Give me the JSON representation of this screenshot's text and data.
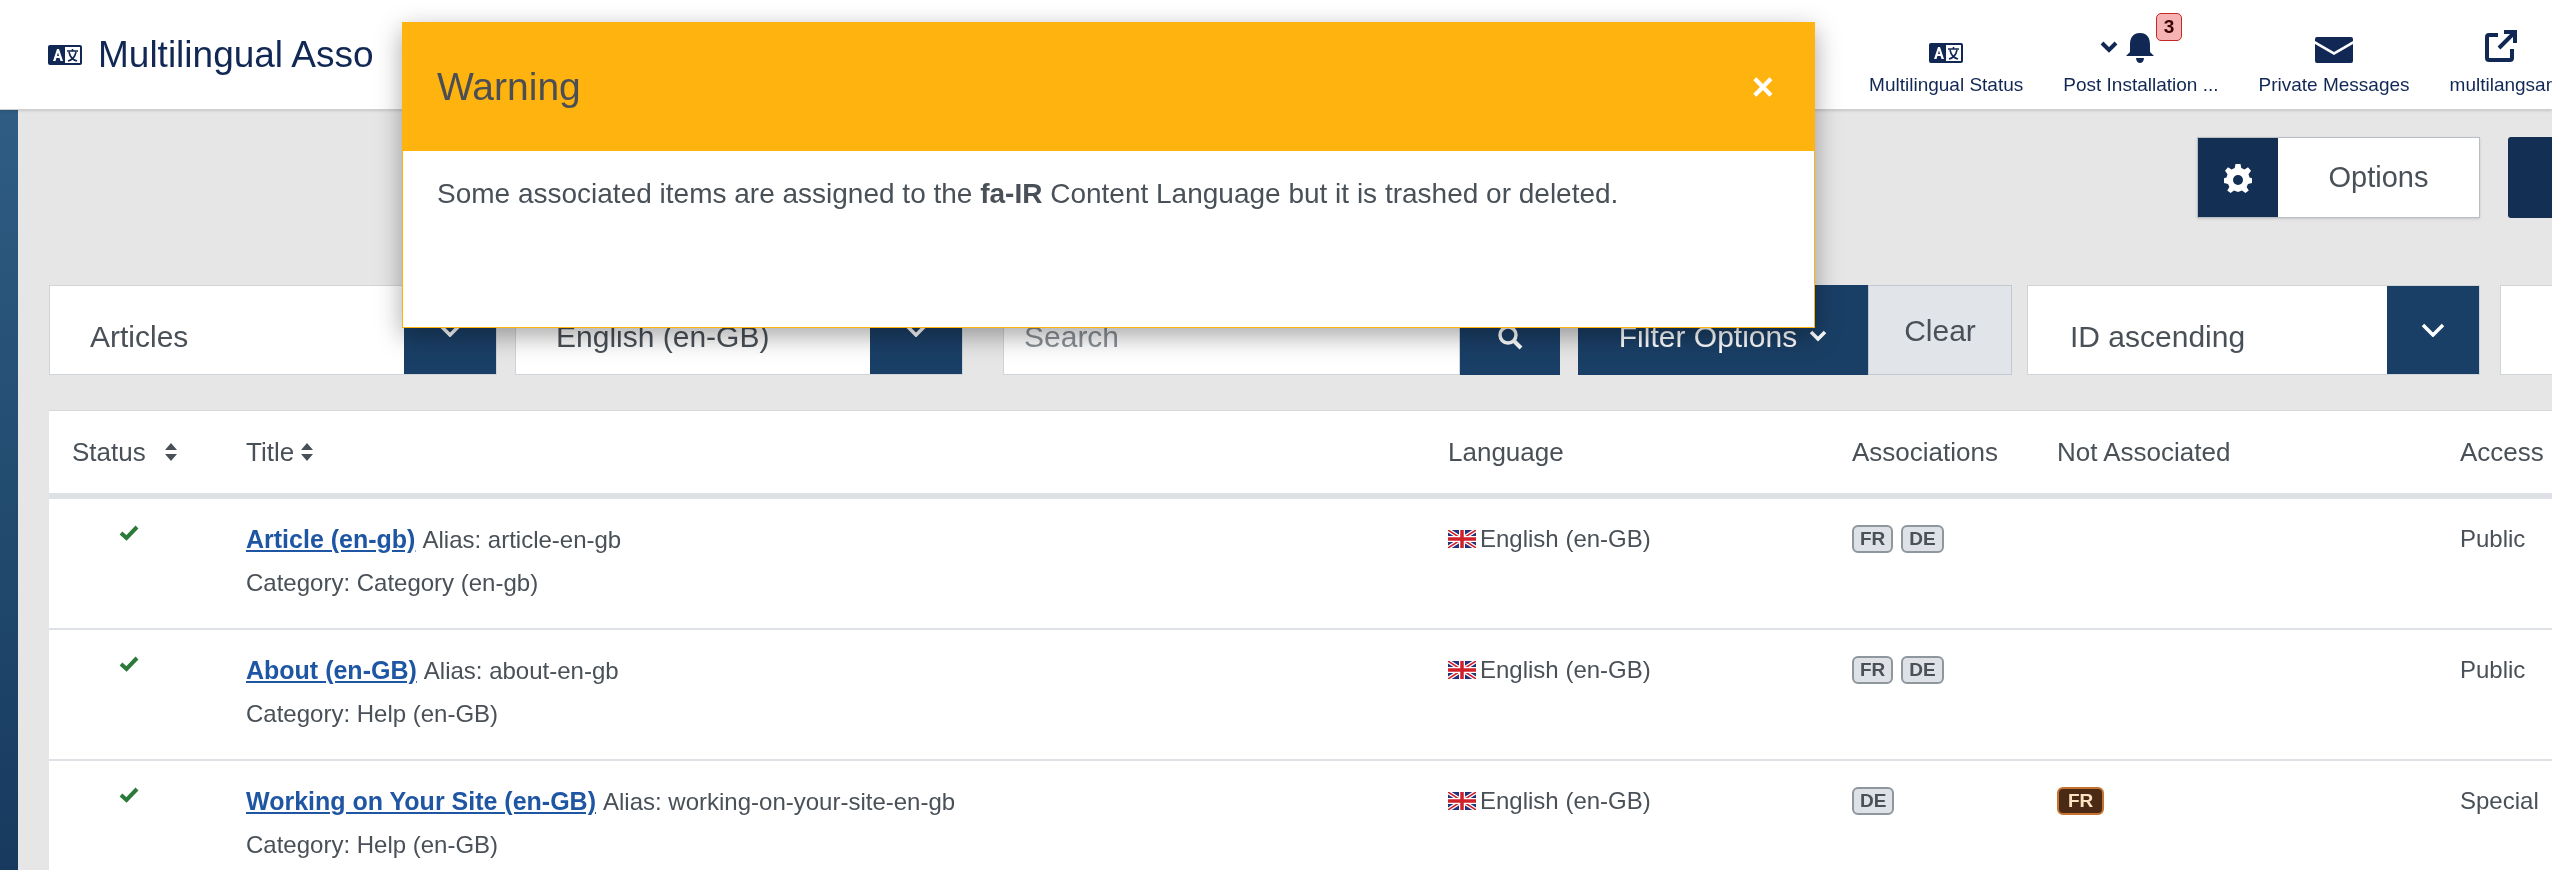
{
  "header": {
    "title": "Multilingual Asso",
    "items": [
      {
        "label": "Multilingual Status"
      },
      {
        "label": "Post Installation ...",
        "badge": "3"
      },
      {
        "label": "Private Messages"
      },
      {
        "label": "multilangsar"
      }
    ]
  },
  "toolbar": {
    "options": "Options"
  },
  "filters": {
    "type_select": "Articles",
    "language_select": "English (en-GB)",
    "search": {
      "placeholder": "Search"
    },
    "filter_options": "Filter Options",
    "clear": "Clear",
    "ordering": "ID ascending"
  },
  "table": {
    "columns": [
      {
        "label": "Status",
        "sortable": true
      },
      {
        "label": "Title",
        "sortable": true
      },
      {
        "label": "Language",
        "sortable": false
      },
      {
        "label": "Associations",
        "sortable": false
      },
      {
        "label": "Not Associated",
        "sortable": false
      },
      {
        "label": "Access",
        "sortable": false
      }
    ],
    "rows": [
      {
        "published": true,
        "title": "Article (en-gb)",
        "alias": "Alias: article-en-gb",
        "category": "Category: Category (en-gb)",
        "language": "English (en-GB)",
        "associations": [
          "FR",
          "DE"
        ],
        "not_associated": [],
        "access": "Public"
      },
      {
        "published": true,
        "title": "About (en-GB)",
        "alias": "Alias: about-en-gb",
        "category": "Category: Help (en-GB)",
        "language": "English (en-GB)",
        "associations": [
          "FR",
          "DE"
        ],
        "not_associated": [],
        "access": "Public"
      },
      {
        "published": true,
        "title": "Working on Your Site (en-GB)",
        "alias": "Alias: working-on-your-site-en-gb",
        "category": "Category: Help (en-GB)",
        "language": "English (en-GB)",
        "associations": [
          "DE"
        ],
        "not_associated": [
          "FR"
        ],
        "access": "Special"
      }
    ]
  },
  "modal": {
    "title": "Warning",
    "close": "×",
    "message": "Some associated items are assigned to the **fa-IR** Content Language but it is trashed or deleted."
  }
}
